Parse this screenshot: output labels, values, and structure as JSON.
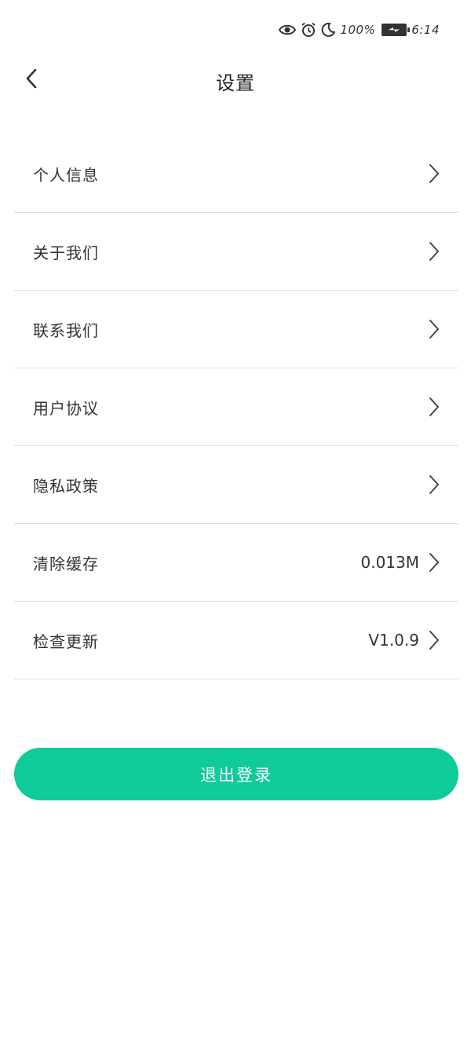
{
  "status_bar": {
    "battery_percent": "100%",
    "time": "6:14",
    "icons": [
      "eye-icon",
      "alarm-icon",
      "moon-icon",
      "battery-charging-icon"
    ]
  },
  "header": {
    "title": "设置",
    "back_icon": "chevron-left-icon"
  },
  "settings": {
    "items": [
      {
        "label": "个人信息",
        "value": ""
      },
      {
        "label": "关于我们",
        "value": ""
      },
      {
        "label": "联系我们",
        "value": ""
      },
      {
        "label": "用户协议",
        "value": ""
      },
      {
        "label": "隐私政策",
        "value": ""
      },
      {
        "label": "清除缓存",
        "value": "0.013M"
      },
      {
        "label": "检查更新",
        "value": "V1.0.9"
      }
    ]
  },
  "logout": {
    "label": "退出登录"
  },
  "colors": {
    "accent": "#0ecb99",
    "divider": "#dedede",
    "text": "#333333"
  }
}
